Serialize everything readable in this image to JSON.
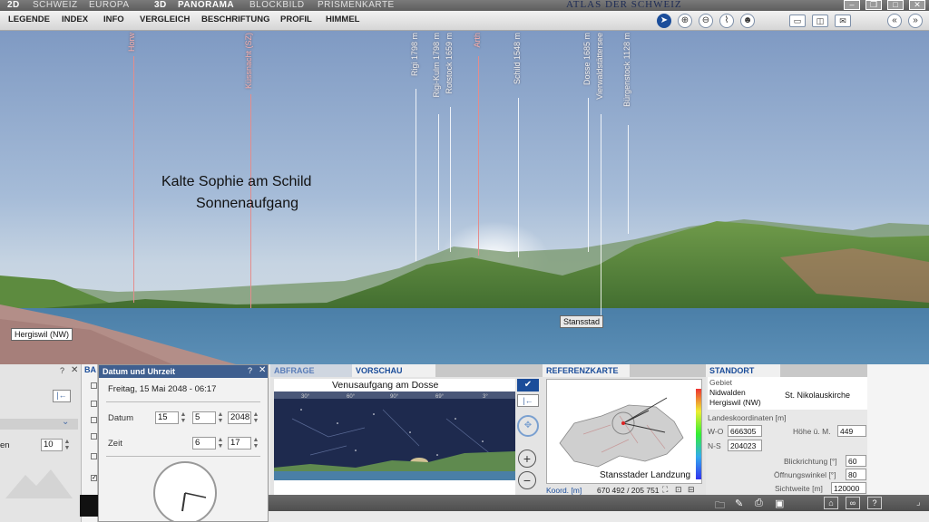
{
  "modebar": {
    "items": [
      "2D",
      "SCHWEIZ",
      "EUROPA",
      "3D",
      "PANORAMA",
      "BLOCKBILD",
      "PRISMENKARTE"
    ],
    "atlas_title": "ATLAS DER SCHWEIZ"
  },
  "menubar": {
    "items": [
      "LEGENDE",
      "INDEX",
      "INFO",
      "VERGLEICH",
      "BESCHRIFTUNG",
      "PROFIL",
      "HIMMEL"
    ]
  },
  "panorama": {
    "peaks": [
      {
        "label": "Horw",
        "red": true
      },
      {
        "label": "Küssnacht (SZ)",
        "red": true
      },
      {
        "label": "Rigi 1798 m",
        "red": false
      },
      {
        "label": "Rigi-Kulm 1798 m",
        "red": false
      },
      {
        "label": "Rotstock 1659 m",
        "red": false
      },
      {
        "label": "Arth",
        "red": true
      },
      {
        "label": "Schild 1548 m",
        "red": false
      },
      {
        "label": "Dosse 1685 m",
        "red": false
      },
      {
        "label": "Vierwaldstättersee",
        "red": false
      },
      {
        "label": "Bürgenstock 1128 m",
        "red": false
      }
    ],
    "caption_line1": "Kalte Sophie am Schild",
    "caption_line2": "Sonnenaufgang",
    "place_left": "Hergiswil (NW)",
    "place_right": "Stansstad"
  },
  "datum_panel": {
    "title": "Datum und Uhrzeit",
    "help": "?",
    "close": "✕",
    "datetime": "Freitag, 15 Mai 2048 - 06:17",
    "datum_label": "Datum",
    "day": "15",
    "month": "5",
    "year": "2048",
    "zeit_label": "Zeit",
    "hour": "6",
    "minute": "17"
  },
  "left_panel": {
    "tab_partial": "BA",
    "field_label": "en",
    "field_value": "10"
  },
  "tabs": {
    "abfrage": "ABFRAGE",
    "vorschau": "VORSCHAU",
    "referenzkarte": "REFERENZKARTE",
    "standort": "STANDORT"
  },
  "vorschau": {
    "title": "Venusaufgang am Dosse",
    "ticks": [
      "30°",
      "60°",
      "90°",
      "69°",
      "3°"
    ]
  },
  "referenzkarte": {
    "map_label": "Stansstader Landzung",
    "koord_label": "Koord. [m]",
    "koord_value": "670 492 / 205 751"
  },
  "standort": {
    "gebiet_label": "Gebiet",
    "gebiet_1": "Nidwalden",
    "gebiet_2": "Hergiswil (NW)",
    "location": "St. Nikolauskirche",
    "koord_title": "Landeskoordinaten [m]",
    "wo_label": "W-O",
    "wo_value": "666305",
    "hoehe_label": "Höhe ü. M.",
    "hoehe_value": "449",
    "ns_label": "N-S",
    "ns_value": "204023",
    "blick_label": "Blickrichtung [°]",
    "blick_value": "60",
    "oeffnung_label": "Öffnungswinkel [°]",
    "oeffnung_value": "80",
    "sicht_label": "Sichtweite [m]",
    "sicht_value": "120000"
  }
}
